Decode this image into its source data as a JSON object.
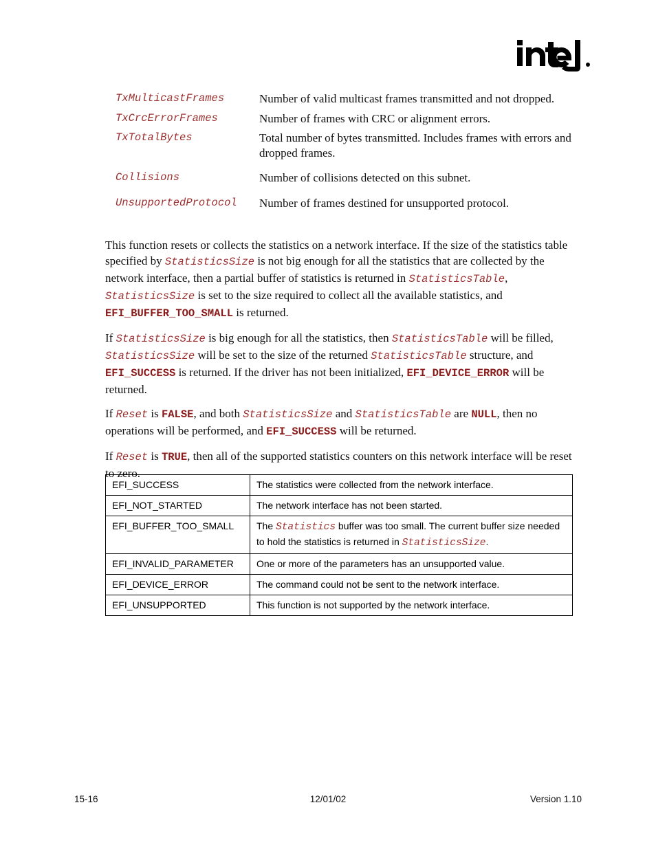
{
  "logo": {
    "brand": "intel",
    "icon_name": "intel-logo"
  },
  "definitions": [
    {
      "term": "TxMulticastFrames",
      "description": "Number of valid multicast frames transmitted and not dropped.",
      "gap_before": false
    },
    {
      "term": "TxCrcErrorFrames",
      "description": "Number of frames with CRC or alignment errors.",
      "gap_before": false
    },
    {
      "term": "TxTotalBytes",
      "description": "Total number of bytes transmitted.  Includes frames with errors and dropped frames.",
      "gap_before": false
    },
    {
      "term": "Collisions",
      "description": "Number of collisions detected on this subnet.",
      "gap_before": true
    },
    {
      "term": "UnsupportedProtocol",
      "description": "Number of frames destined for unsupported protocol.",
      "gap_before": true
    }
  ],
  "paragraphs": [
    {
      "id": "para-1",
      "runs": [
        {
          "type": "text",
          "value": "This function resets or collects the statistics on a network interface.  If the size of the statistics table specified by "
        },
        {
          "type": "mono-italic",
          "value": "StatisticsSize"
        },
        {
          "type": "text",
          "value": " is not big enough for all the statistics that are collected by the network interface, then a partial buffer of statistics is returned in "
        },
        {
          "type": "mono-italic",
          "value": "StatisticsTable"
        },
        {
          "type": "text",
          "value": ", "
        },
        {
          "type": "mono-italic",
          "value": "StatisticsSize"
        },
        {
          "type": "text",
          "value": " is set to the size required to collect all the available statistics, and "
        },
        {
          "type": "mono-bold",
          "value": "EFI_BUFFER_TOO_SMALL"
        },
        {
          "type": "text",
          "value": " is returned."
        }
      ]
    },
    {
      "id": "para-2",
      "runs": [
        {
          "type": "text",
          "value": "If "
        },
        {
          "type": "mono-italic",
          "value": "StatisticsSize"
        },
        {
          "type": "text",
          "value": " is big enough for all the statistics, then "
        },
        {
          "type": "mono-italic",
          "value": "StatisticsTable"
        },
        {
          "type": "text",
          "value": " will be filled, "
        },
        {
          "type": "mono-italic",
          "value": "StatisticsSize"
        },
        {
          "type": "text",
          "value": " will be set to the size of the returned "
        },
        {
          "type": "mono-italic",
          "value": "StatisticsTable"
        },
        {
          "type": "text",
          "value": " structure, and "
        },
        {
          "type": "mono-bold",
          "value": "EFI_SUCCESS"
        },
        {
          "type": "text",
          "value": " is returned.  If the driver has not been initialized, "
        },
        {
          "type": "mono-bold",
          "value": "EFI_DEVICE_ERROR"
        },
        {
          "type": "text",
          "value": " will be returned."
        }
      ]
    },
    {
      "id": "para-3",
      "runs": [
        {
          "type": "text",
          "value": "If "
        },
        {
          "type": "mono-italic",
          "value": "Reset"
        },
        {
          "type": "text",
          "value": " is "
        },
        {
          "type": "mono-bold",
          "value": "FALSE"
        },
        {
          "type": "text",
          "value": ", and both "
        },
        {
          "type": "mono-italic",
          "value": "StatisticsSize"
        },
        {
          "type": "text",
          "value": " and "
        },
        {
          "type": "mono-italic",
          "value": "StatisticsTable"
        },
        {
          "type": "text",
          "value": " are "
        },
        {
          "type": "mono-bold",
          "value": "NULL"
        },
        {
          "type": "text",
          "value": ", then no operations will be performed, and "
        },
        {
          "type": "mono-bold",
          "value": "EFI_SUCCESS"
        },
        {
          "type": "text",
          "value": " will be returned."
        }
      ]
    },
    {
      "id": "para-4",
      "runs": [
        {
          "type": "text",
          "value": "If "
        },
        {
          "type": "mono-italic",
          "value": "Reset"
        },
        {
          "type": "text",
          "value": " is "
        },
        {
          "type": "mono-bold",
          "value": "TRUE"
        },
        {
          "type": "text",
          "value": ", then all of the supported statistics counters on this network interface will be reset to zero."
        }
      ]
    }
  ],
  "status_table": {
    "rows": [
      {
        "code": "EFI_SUCCESS",
        "description_runs": [
          {
            "type": "text",
            "value": "The statistics were collected from the network interface."
          }
        ]
      },
      {
        "code": "EFI_NOT_STARTED",
        "description_runs": [
          {
            "type": "text",
            "value": "The network interface has not been started."
          }
        ]
      },
      {
        "code": "EFI_BUFFER_TOO_SMALL",
        "description_runs": [
          {
            "type": "text",
            "value": "The "
          },
          {
            "type": "mono-italic",
            "value": "Statistics"
          },
          {
            "type": "text",
            "value": " buffer was too small.  The current buffer size needed to hold the statistics is returned in "
          },
          {
            "type": "mono-italic",
            "value": "StatisticsSize"
          },
          {
            "type": "text",
            "value": "."
          }
        ]
      },
      {
        "code": "EFI_INVALID_PARAMETER",
        "description_runs": [
          {
            "type": "text",
            "value": "One or more of the parameters has an unsupported value."
          }
        ]
      },
      {
        "code": "EFI_DEVICE_ERROR",
        "description_runs": [
          {
            "type": "text",
            "value": "The command could not be sent to the network interface."
          }
        ]
      },
      {
        "code": "EFI_UNSUPPORTED",
        "description_runs": [
          {
            "type": "text",
            "value": "This function is not supported by the network interface."
          }
        ]
      }
    ]
  },
  "footer": {
    "page_number": "15-16",
    "date": "12/01/02",
    "version": "Version 1.10"
  },
  "colors": {
    "code_italic": "#9c3030",
    "code_bold": "#8b1a1a",
    "text": "#111111",
    "table_border": "#000000"
  }
}
